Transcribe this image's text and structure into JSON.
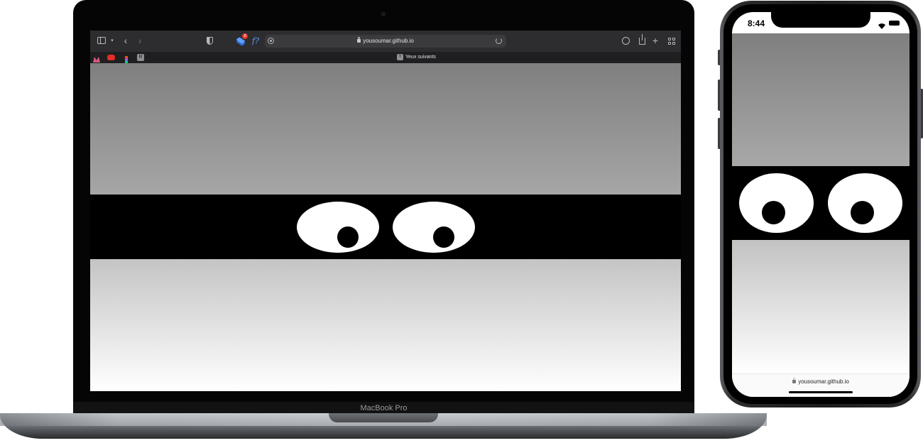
{
  "laptop": {
    "brand_label": "MacBook Pro",
    "browser": {
      "url": "yousoumar.github.io",
      "tab_title": "Yeux suivants",
      "tab_favicon_letter": "Y",
      "favorites": [
        {
          "name": "favorite-1",
          "color": "#c44a6a"
        },
        {
          "name": "youtube",
          "color": "#e52d27"
        },
        {
          "name": "figma",
          "color": "#f24e1e"
        },
        {
          "name": "favorite-r",
          "letter": "R",
          "color": "#8e8e93"
        }
      ],
      "extension_badge": "8"
    }
  },
  "phone": {
    "time": "8:44",
    "url": "yousoumar.github.io"
  },
  "colors": {
    "background_top_from": "#7f7f7f",
    "background_top_to": "#a6a6a6",
    "band": "#000000",
    "background_bottom_from": "#c4c4c4",
    "background_bottom_to": "#ffffff",
    "eye_white": "#ffffff",
    "pupil": "#000000"
  }
}
